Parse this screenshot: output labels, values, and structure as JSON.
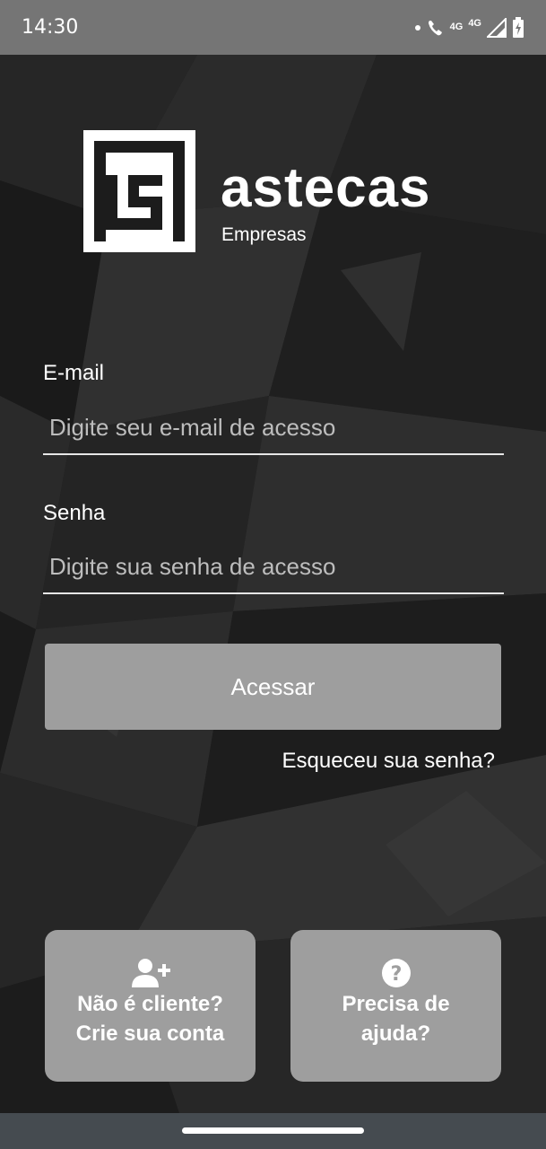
{
  "status_bar": {
    "time": "14:30",
    "network_label_1": "4G",
    "network_label_2": "4G",
    "icons": [
      "dot-icon",
      "wifi-call-icon",
      "signal-icon",
      "battery-charging-icon"
    ]
  },
  "brand": {
    "name": "astecas",
    "subtitle": "Empresas"
  },
  "form": {
    "email": {
      "label": "E-mail",
      "placeholder": "Digite seu e-mail de acesso",
      "value": ""
    },
    "password": {
      "label": "Senha",
      "placeholder": "Digite sua senha de acesso",
      "value": ""
    },
    "submit_label": "Acessar",
    "forgot_label": "Esqueceu sua senha?"
  },
  "cards": {
    "signup": {
      "icon": "add-user-icon",
      "line1": "Não é cliente?",
      "line2": "Crie sua conta"
    },
    "help": {
      "icon": "help-circle-icon",
      "line1": "Precisa de",
      "line2": "ajuda?"
    }
  },
  "colors": {
    "background": "#1c1c1c",
    "button": "#9e9e9e",
    "status_bar": "#757575",
    "nav_bar": "#454b50"
  }
}
